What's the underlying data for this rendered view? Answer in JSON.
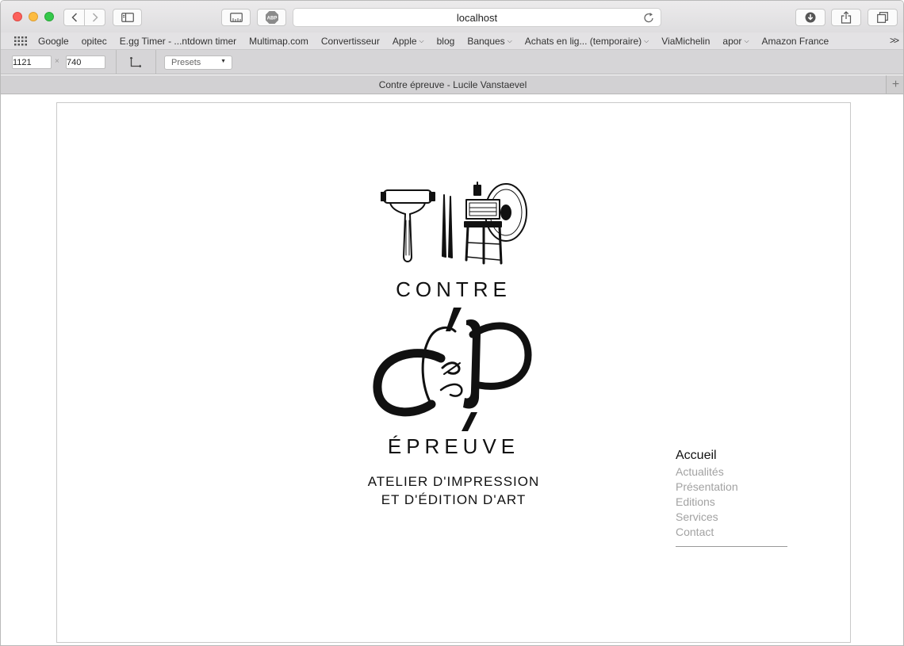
{
  "browser": {
    "url": "localhost",
    "bookmarks": [
      {
        "label": "Google",
        "menu": false
      },
      {
        "label": "opitec",
        "menu": false
      },
      {
        "label": "E.gg Timer - ...ntdown timer",
        "menu": false
      },
      {
        "label": "Multimap.com",
        "menu": false
      },
      {
        "label": "Convertisseur",
        "menu": false
      },
      {
        "label": "Apple",
        "menu": true
      },
      {
        "label": "blog",
        "menu": false
      },
      {
        "label": "Banques",
        "menu": true
      },
      {
        "label": "Achats en lig... (temporaire)",
        "menu": true
      },
      {
        "label": "ViaMichelin",
        "menu": false
      },
      {
        "label": "apor",
        "menu": true
      },
      {
        "label": "Amazon France",
        "menu": false
      }
    ],
    "bookmarks_overflow": ">>",
    "responsive": {
      "width": "1121",
      "height": "740",
      "times": "×",
      "presets_label": "Presets"
    },
    "tab_title": "Contre épreuve - Lucile Vanstaevel",
    "new_tab": "+"
  },
  "site": {
    "brand_top": "CONTRE",
    "brand_bottom": "ÉPREUVE",
    "tagline_line1": "ATELIER D'IMPRESSION",
    "tagline_line2": "ET D'ÉDITION D'ART",
    "menu": [
      {
        "label": "Accueil",
        "active": true
      },
      {
        "label": "Actualités",
        "active": false
      },
      {
        "label": "Présentation",
        "active": false
      },
      {
        "label": "Editions",
        "active": false
      },
      {
        "label": "Services",
        "active": false
      },
      {
        "label": "Contact",
        "active": false
      }
    ]
  },
  "colors": {
    "menu_active": "#111111",
    "menu_inactive": "#a2a2a2",
    "close": "#fc605b",
    "minimize": "#fdbc40",
    "maximize": "#34c84a"
  }
}
